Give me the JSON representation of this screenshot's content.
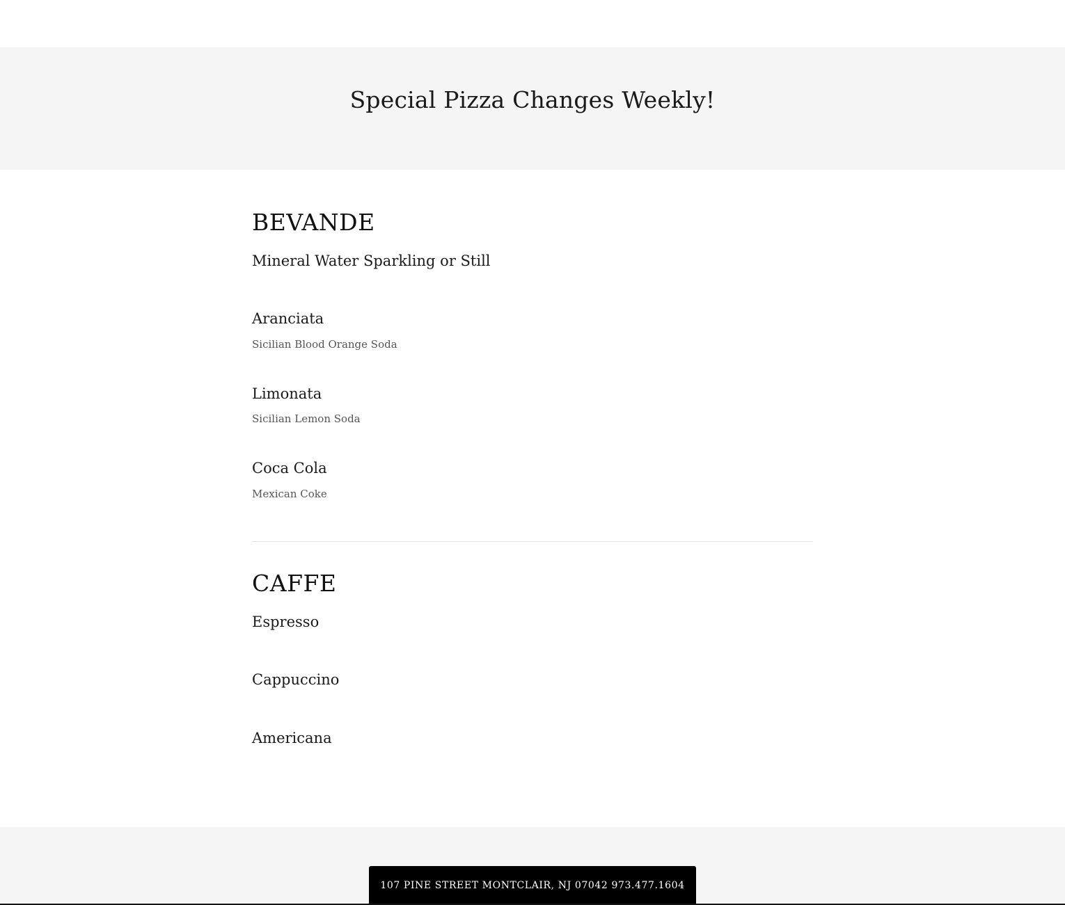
{
  "banner": {
    "title": "Special Pizza Changes Weekly!"
  },
  "sections": {
    "bevande": {
      "title": "BEVANDE",
      "items": [
        {
          "name": "Mineral Water Sparkling or Still",
          "desc": ""
        },
        {
          "name": "Aranciata",
          "desc": "Sicilian Blood Orange Soda"
        },
        {
          "name": "Limonata",
          "desc": "Sicilian Lemon Soda"
        },
        {
          "name": "Coca Cola",
          "desc": "Mexican Coke"
        }
      ]
    },
    "caffe": {
      "title": "CAFFE",
      "items": [
        {
          "name": "Espresso"
        },
        {
          "name": "Cappuccino"
        },
        {
          "name": "Americana"
        }
      ]
    }
  },
  "footer": {
    "address": "107 PINE STREET MONTCLAIR, NJ 07042 973.477.1604"
  }
}
